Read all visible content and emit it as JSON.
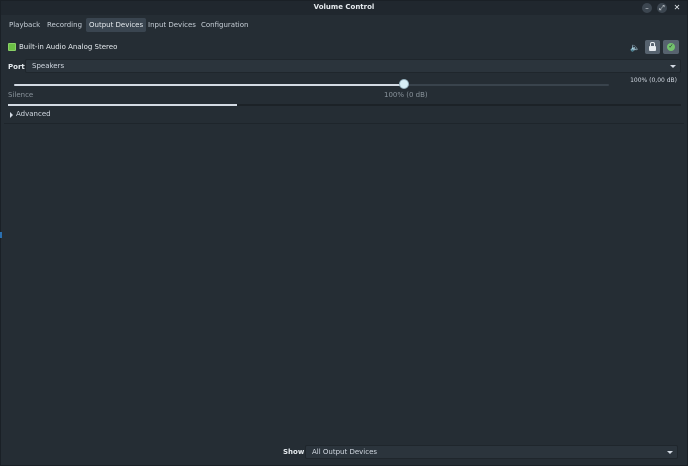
{
  "window": {
    "title": "Volume Control",
    "controls": {
      "minimize_icon": "minimize-icon",
      "maximize_icon": "maximize-icon",
      "close_icon": "close-icon"
    }
  },
  "tabs": [
    {
      "label": "Playback"
    },
    {
      "label": "Recording"
    },
    {
      "label": "Output Devices",
      "active": true
    },
    {
      "label": "Input Devices"
    },
    {
      "label": "Configuration"
    }
  ],
  "device": {
    "name": "Built-in Audio Analog Stereo",
    "icon": "audio-card-icon",
    "port_label": "Port:",
    "port_value": "Speakers",
    "volume_readout": "100% (0,00 dB)",
    "volume_fraction": 1.0,
    "peak_fraction": 0.34,
    "mark_silence": "Silence",
    "mark_100": "100% (0 dB)",
    "advanced_label": "Advanced",
    "buttons": {
      "mute_icon": "speaker-icon",
      "lock_icon": "lock-icon",
      "default_icon": "checkmark-icon"
    }
  },
  "footer": {
    "show_label": "Show:",
    "show_value": "All Output Devices"
  },
  "colors": {
    "background": "#252d34",
    "device_icon": "#6bbf45",
    "default_check": "#73c26d"
  }
}
